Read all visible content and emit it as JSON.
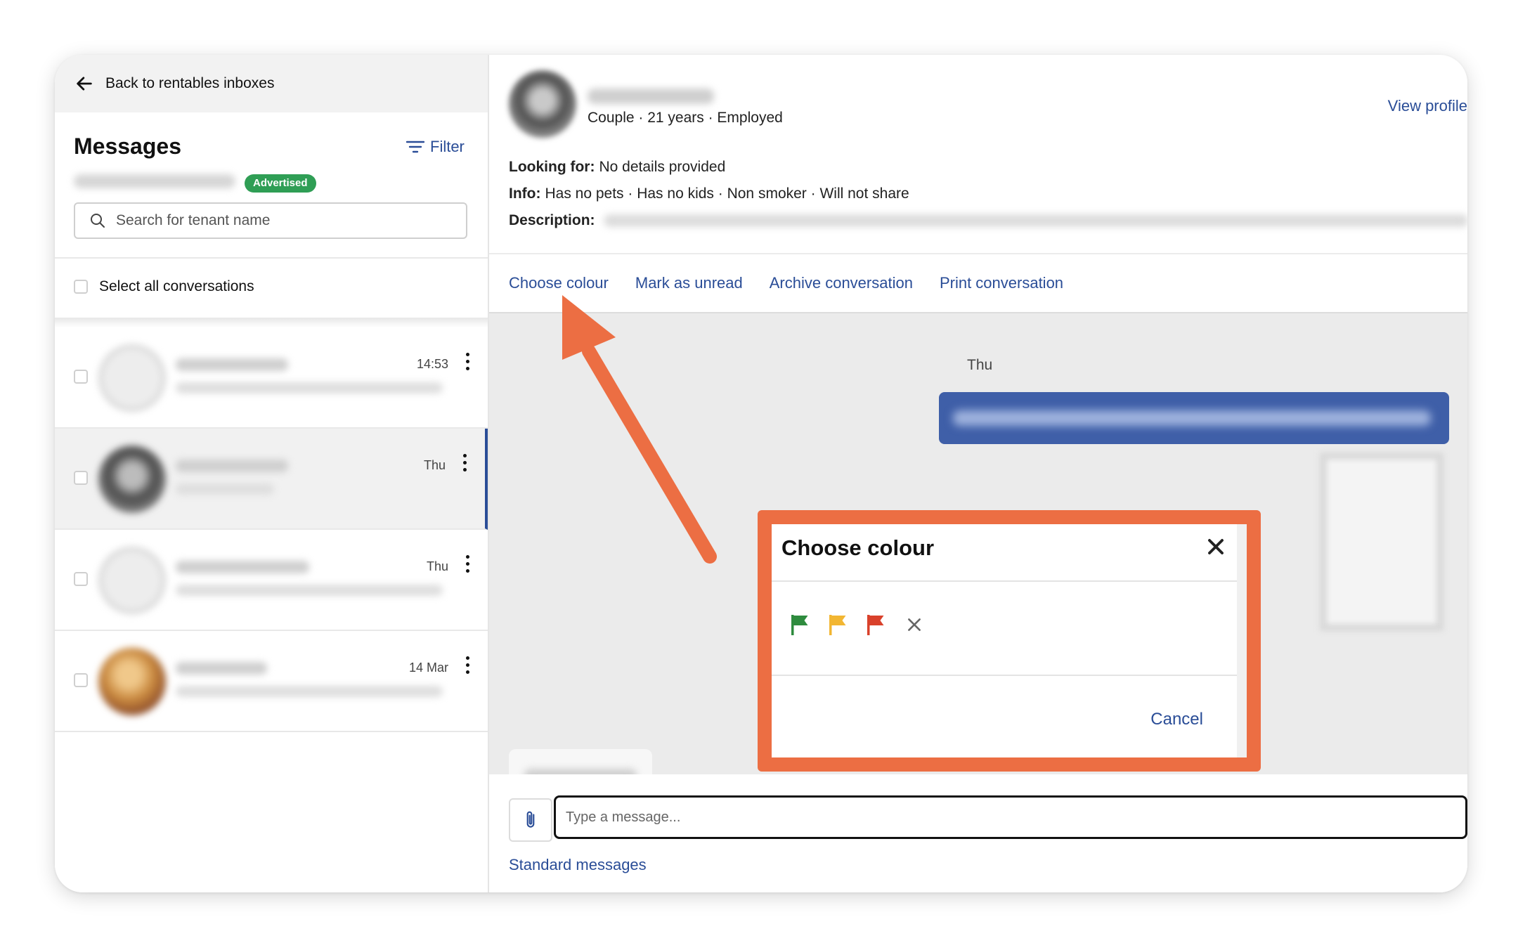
{
  "sidebar": {
    "back_label": "Back to rentables inboxes",
    "title": "Messages",
    "filter_label": "Filter",
    "badge": "Advertised",
    "search_placeholder": "Search for tenant name",
    "select_all_label": "Select all conversations",
    "conversations": [
      {
        "time": "14:53",
        "avatar": "empty"
      },
      {
        "time": "Thu",
        "avatar": "photo",
        "active": true
      },
      {
        "time": "Thu",
        "avatar": "empty"
      },
      {
        "time": "14 Mar",
        "avatar": "photo"
      }
    ]
  },
  "profile": {
    "subtitle": "Couple · 21 years · Employed",
    "view_profile": "View profile",
    "looking_for_label": "Looking for:",
    "looking_for_value": "No details provided",
    "info_label": "Info:",
    "info_value": "Has no pets · Has no kids · Non smoker · Will not share",
    "description_label": "Description:"
  },
  "actions": {
    "choose_colour": "Choose colour",
    "mark_unread": "Mark as unread",
    "archive": "Archive conversation",
    "print": "Print conversation"
  },
  "thread": {
    "day_label": "Thu"
  },
  "compose": {
    "placeholder": "Type a message...",
    "standard_messages": "Standard messages"
  },
  "modal": {
    "title": "Choose colour",
    "flags": [
      "green-flag",
      "yellow-flag",
      "red-flag"
    ],
    "cancel_label": "Cancel"
  },
  "colors": {
    "accent": "#2a4d97",
    "badge": "#2f9e55",
    "highlight": "#ec6e43",
    "flag_green": "#2e8b3e",
    "flag_yellow": "#f2b632",
    "flag_red": "#d9412b",
    "outgoing_bubble": "#3f5fa8"
  }
}
